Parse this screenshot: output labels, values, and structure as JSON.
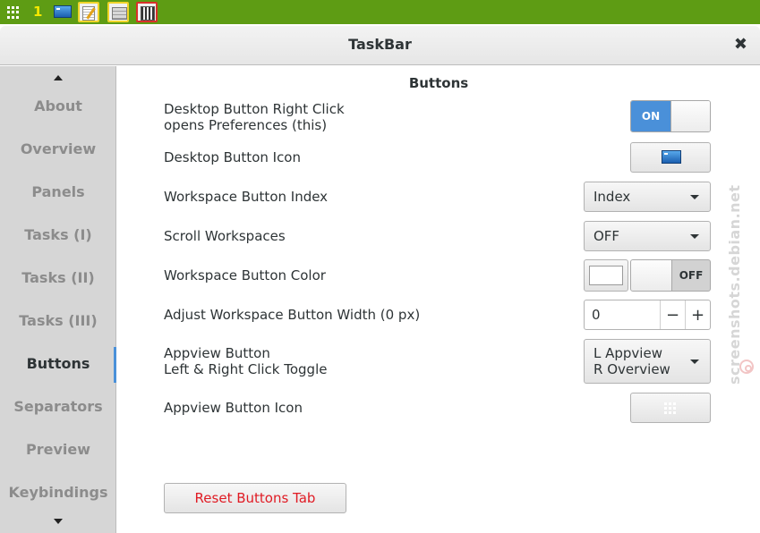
{
  "top_panel": {
    "workspace_index": "1",
    "icons": [
      "appview-grid-icon",
      "desktop-icon",
      "text-editor-icon",
      "file-manager-icon",
      "settings-icon"
    ]
  },
  "window": {
    "title": "TaskBar",
    "close_label": "✖"
  },
  "sidebar": {
    "items": [
      {
        "label": "About"
      },
      {
        "label": "Overview"
      },
      {
        "label": "Panels"
      },
      {
        "label": "Tasks (I)"
      },
      {
        "label": "Tasks (II)"
      },
      {
        "label": "Tasks (III)"
      },
      {
        "label": "Buttons"
      },
      {
        "label": "Separators"
      },
      {
        "label": "Preview"
      },
      {
        "label": "Keybindings"
      }
    ],
    "active": "Buttons"
  },
  "main": {
    "section_title": "Buttons",
    "rows": {
      "desktop_right_click": {
        "label_line1": "Desktop Button Right Click",
        "label_line2": "opens Preferences (this)",
        "switch_text": "ON"
      },
      "desktop_icon": {
        "label": "Desktop Button Icon"
      },
      "workspace_index": {
        "label": "Workspace Button Index",
        "value": "Index"
      },
      "scroll_workspaces": {
        "label": "Scroll Workspaces",
        "value": "OFF"
      },
      "workspace_color": {
        "label": "Workspace Button Color",
        "switch_text": "OFF",
        "color": "#ffffff"
      },
      "workspace_width": {
        "label": "Adjust Workspace Button Width (0 px)",
        "value": "0",
        "minus": "−",
        "plus": "+"
      },
      "appview_button": {
        "label_line1": "Appview Button",
        "label_line2": "Left & Right Click Toggle",
        "value_line1": "L Appview",
        "value_line2": "R Overview"
      },
      "appview_icon": {
        "label": "Appview Button Icon"
      }
    },
    "reset_label": "Reset Buttons Tab"
  },
  "colors": {
    "panel_green": "#5e9c14",
    "switch_blue": "#4a90d9",
    "reset_red": "#e01b24"
  },
  "watermark": "screenshots.debian.net"
}
